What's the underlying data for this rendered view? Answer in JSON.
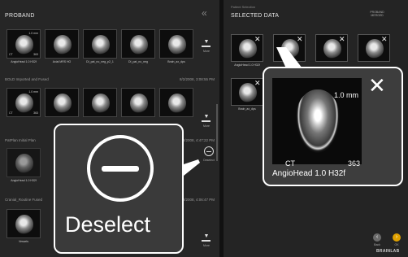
{
  "left_panel": {
    "title": "PROBAND",
    "collapse_glyph": "«",
    "rows": [
      {
        "thumbs": [
          {
            "label": "AngioHead 1.0 H32f",
            "mm": "1.0 mm",
            "modality": "CT",
            "count": "363"
          },
          {
            "label": "Axial MRS HO"
          },
          {
            "label": "DI_pat_no_neg_p2_1"
          },
          {
            "label": "DI_pat_no_neg"
          },
          {
            "label": "Brain_ax_dps"
          }
        ],
        "more_label": "More"
      },
      {
        "section_title": "BOLD Imported and Fused",
        "section_date": "8/2/2008, 3:08:55 PM",
        "thumbs": [
          {
            "label": "AngioHead 1.0 H32f",
            "mm": "1.0 mm",
            "modality": "CT",
            "count": "363"
          },
          {
            "label": ""
          },
          {
            "label": ""
          },
          {
            "label": ""
          },
          {
            "label": ""
          }
        ],
        "more_label": "More"
      },
      {
        "section_title": "PatPlan Initial Plan",
        "section_date": "8/2/2008, 4:47:22 PM",
        "thumbs": [
          {
            "label": "AngioHead 1.0 H32f"
          }
        ],
        "deselect_label": "Deselect"
      },
      {
        "section_title": "Cranial_Routine Fused",
        "section_date": "8/2/2008, 4:06:47 PM",
        "thumbs": [
          {
            "label": "Vessels"
          }
        ],
        "more_label": "More"
      }
    ]
  },
  "right_panel": {
    "small_header": "Patient Selection",
    "title": "SELECTED DATA",
    "top_right_label": "PROBAND MERGED",
    "selected": [
      {
        "label": "AngioHead 1.0 H32f"
      },
      {
        "label": ""
      },
      {
        "label": ""
      },
      {
        "label": ""
      },
      {
        "label": "Brain_ax_dps"
      }
    ],
    "back_label": "Back",
    "ok_label": "OK",
    "brand": "BRAINLAB"
  },
  "zoom_selected": {
    "mm": "1.0 mm",
    "modality": "CT",
    "count": "363",
    "name": "AngioHead 1.0 H32f",
    "close_glyph": "✕"
  },
  "zoom_deselect": {
    "label": "Deselect"
  },
  "colors": {
    "background": "#1a1a1a",
    "panel": "#262626",
    "highlight_border": "#ffffff",
    "back_button": "#6b6b6b",
    "ok_button": "#e0a100"
  },
  "icons": {
    "collapse": "double-chevron-left-icon",
    "more": "chevron-down-bar-icon",
    "deselect": "minus-circle-icon",
    "remove": "close-icon",
    "back": "chevron-left-icon",
    "ok": "chevron-right-icon"
  }
}
